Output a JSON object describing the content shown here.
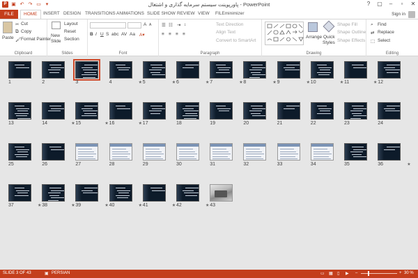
{
  "app": {
    "title": "پاورپوینت سیستم سرمایه گذاری و اشتغال - PowerPoint",
    "ppt_badge": "P",
    "sign_in": "Sign in",
    "window_controls": [
      "?",
      "▢",
      "–",
      "▫",
      "✕"
    ]
  },
  "tabs": [
    "FILE",
    "HOME",
    "INSERT",
    "DESIGN",
    "TRANSITIONS",
    "ANIMATIONS",
    "SLIDE SHOW",
    "REVIEW",
    "VIEW",
    "FILEminimizer"
  ],
  "active_tab": "HOME",
  "ribbon": {
    "clipboard": {
      "label": "Clipboard",
      "paste": "Paste",
      "cut": "Cut",
      "copy": "Copy",
      "format_painter": "Format Painter"
    },
    "slides": {
      "label": "Slides",
      "new_slide": "New",
      "new_slide_2": "Slide",
      "layout": "Layout",
      "reset": "Reset",
      "section": "Section"
    },
    "font": {
      "label": "Font",
      "bold": "B",
      "italic": "I",
      "underline": "U",
      "strike": "S",
      "shadow": "abc",
      "spacing": "AV",
      "case": "Aa",
      "grow": "A",
      "shrink": "A"
    },
    "paragraph": {
      "label": "Paragraph",
      "text_direction": "Text Direction",
      "align_text": "Align Text",
      "smartart": "Convert to SmartArt"
    },
    "drawing": {
      "label": "Drawing",
      "arrange": "Arrange",
      "quick_styles": "Quick",
      "quick_styles_2": "Styles",
      "shape_fill": "Shape Fill",
      "shape_outline": "Shape Outline",
      "shape_effects": "Shape Effects"
    },
    "editing": {
      "label": "Editing",
      "find": "Find",
      "replace": "Replace",
      "select": "Select"
    }
  },
  "slides": [
    {
      "n": "1",
      "star": false,
      "kind": "dark"
    },
    {
      "n": "2",
      "star": false,
      "kind": "dark"
    },
    {
      "n": "3",
      "star": false,
      "kind": "dark",
      "selected": true
    },
    {
      "n": "4",
      "star": true,
      "kind": "dark"
    },
    {
      "n": "5",
      "star": true,
      "kind": "dark"
    },
    {
      "n": "6",
      "star": true,
      "kind": "dark"
    },
    {
      "n": "7",
      "star": true,
      "kind": "dark"
    },
    {
      "n": "8",
      "star": true,
      "kind": "dark"
    },
    {
      "n": "9",
      "star": true,
      "kind": "dark"
    },
    {
      "n": "10",
      "star": true,
      "kind": "dark"
    },
    {
      "n": "11",
      "star": true,
      "kind": "dark"
    },
    {
      "n": "12",
      "star": false,
      "kind": "dark"
    },
    {
      "n": "13",
      "star": false,
      "kind": "dark"
    },
    {
      "n": "14",
      "star": true,
      "kind": "dark"
    },
    {
      "n": "15",
      "star": true,
      "kind": "dark"
    },
    {
      "n": "16",
      "star": true,
      "kind": "dark"
    },
    {
      "n": "17",
      "star": false,
      "kind": "dark"
    },
    {
      "n": "18",
      "star": false,
      "kind": "dark"
    },
    {
      "n": "19",
      "star": false,
      "kind": "dark"
    },
    {
      "n": "20",
      "star": false,
      "kind": "dark"
    },
    {
      "n": "21",
      "star": false,
      "kind": "dark"
    },
    {
      "n": "22",
      "star": false,
      "kind": "dark"
    },
    {
      "n": "23",
      "star": false,
      "kind": "dark"
    },
    {
      "n": "24",
      "star": false,
      "kind": "dark"
    },
    {
      "n": "25",
      "star": false,
      "kind": "dark"
    },
    {
      "n": "26",
      "star": false,
      "kind": "dark"
    },
    {
      "n": "27",
      "star": false,
      "kind": "shot"
    },
    {
      "n": "28",
      "star": false,
      "kind": "shot"
    },
    {
      "n": "29",
      "star": false,
      "kind": "shot"
    },
    {
      "n": "30",
      "star": false,
      "kind": "shot"
    },
    {
      "n": "31",
      "star": false,
      "kind": "shot"
    },
    {
      "n": "32",
      "star": false,
      "kind": "shot"
    },
    {
      "n": "33",
      "star": false,
      "kind": "shot"
    },
    {
      "n": "34",
      "star": false,
      "kind": "shot"
    },
    {
      "n": "35",
      "star": false,
      "kind": "dark"
    },
    {
      "n": "36",
      "star": true,
      "kind": "dark"
    },
    {
      "n": "37",
      "star": true,
      "kind": "dark"
    },
    {
      "n": "38",
      "star": true,
      "kind": "dark"
    },
    {
      "n": "39",
      "star": true,
      "kind": "dark"
    },
    {
      "n": "40",
      "star": true,
      "kind": "dark"
    },
    {
      "n": "41",
      "star": true,
      "kind": "dark"
    },
    {
      "n": "42",
      "star": true,
      "kind": "dark"
    },
    {
      "n": "43",
      "star": false,
      "kind": "photo"
    }
  ],
  "star_glyph": "★",
  "status": {
    "slide_count": "SLIDE 3 OF 43",
    "language": "PERSIAN",
    "zoom": "30 %"
  },
  "colors": {
    "accent": "#c43e1c",
    "selection": "#d04a2a",
    "dark_slide": "#0d1b2a"
  }
}
